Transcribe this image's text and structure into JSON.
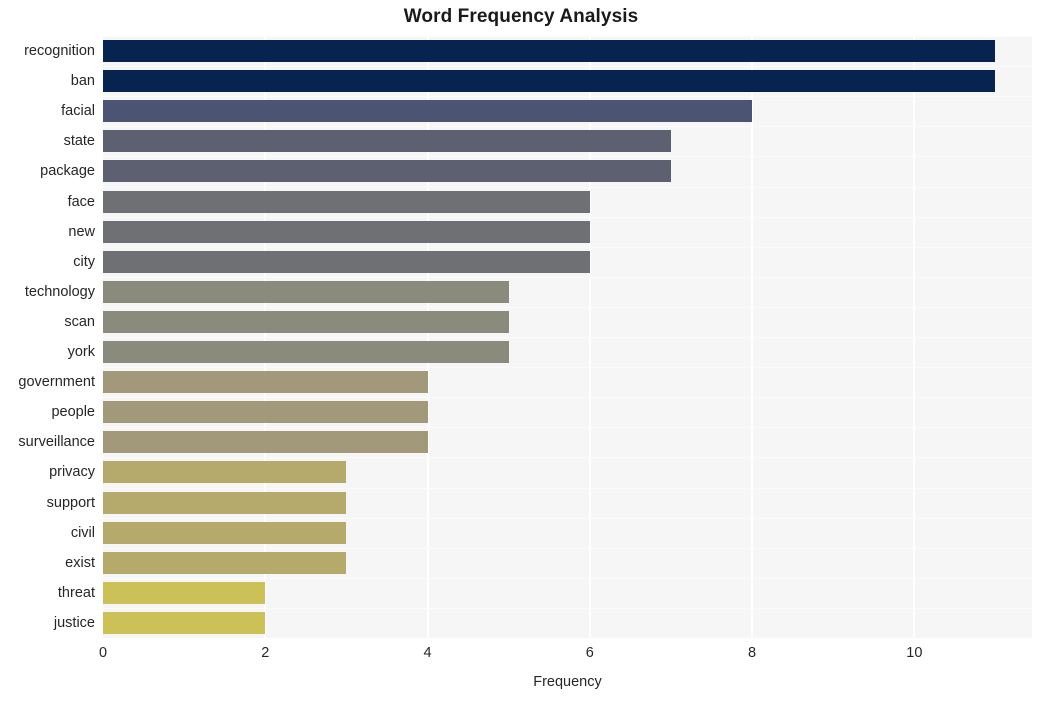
{
  "chart_data": {
    "type": "bar",
    "orientation": "horizontal",
    "title": "Word Frequency Analysis",
    "xlabel": "Frequency",
    "ylabel": "",
    "categories": [
      "recognition",
      "ban",
      "facial",
      "state",
      "package",
      "face",
      "new",
      "city",
      "technology",
      "scan",
      "york",
      "government",
      "people",
      "surveillance",
      "privacy",
      "support",
      "civil",
      "exist",
      "threat",
      "justice"
    ],
    "values": [
      11,
      11,
      8,
      7,
      7,
      6,
      6,
      6,
      5,
      5,
      5,
      4,
      4,
      4,
      3,
      3,
      3,
      3,
      2,
      2
    ],
    "bar_colors": [
      "#06244f",
      "#06244f",
      "#4b5472",
      "#5d6070",
      "#5d6070",
      "#6f7073",
      "#6f7073",
      "#6f7073",
      "#8a8a7d",
      "#8a8a7d",
      "#8a8a7d",
      "#a2997b",
      "#a2997b",
      "#a2997b",
      "#b5a96b",
      "#b5a96b",
      "#b5a96b",
      "#b5a96b",
      "#ccc058",
      "#ccc058"
    ],
    "xticks": [
      0,
      2,
      4,
      6,
      8,
      10
    ],
    "xtick_labels": [
      "0",
      "2",
      "4",
      "6",
      "8",
      "10"
    ],
    "xlim": [
      0,
      11.45
    ],
    "grid": true,
    "grid_color": "#ffffff",
    "plot_background": "#f6f6f7",
    "figure_background": "#ffffff",
    "legend": null
  }
}
